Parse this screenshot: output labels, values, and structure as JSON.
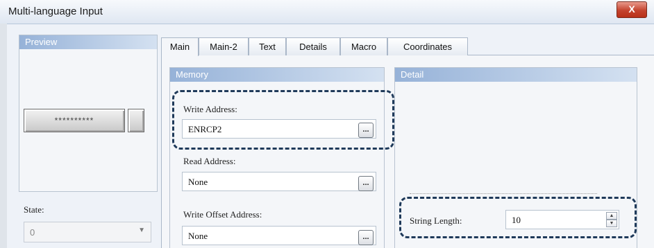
{
  "window": {
    "title": "Multi-language Input",
    "close_glyph": "X"
  },
  "preview": {
    "header": "Preview",
    "button_text": "**********",
    "state_label": "State:",
    "state_value": "0"
  },
  "tabs": [
    {
      "label": "Main",
      "active": true
    },
    {
      "label": "Main-2",
      "active": false
    },
    {
      "label": "Text",
      "active": false
    },
    {
      "label": "Details",
      "active": false
    },
    {
      "label": "Macro",
      "active": false
    },
    {
      "label": "Coordinates",
      "active": false
    }
  ],
  "memory": {
    "header": "Memory",
    "write_address_label": "Write Address:",
    "write_address_value": "ENRCP2",
    "read_address_label": "Read Address:",
    "read_address_value": "None",
    "write_offset_label": "Write Offset Address:",
    "write_offset_value": "None",
    "browse_glyph": "..."
  },
  "detail": {
    "header": "Detail",
    "string_length_label": "String Length:",
    "string_length_value": "10"
  },
  "colors": {
    "highlight_border": "#1f3a5a",
    "panel_header": "#96b2d8"
  }
}
